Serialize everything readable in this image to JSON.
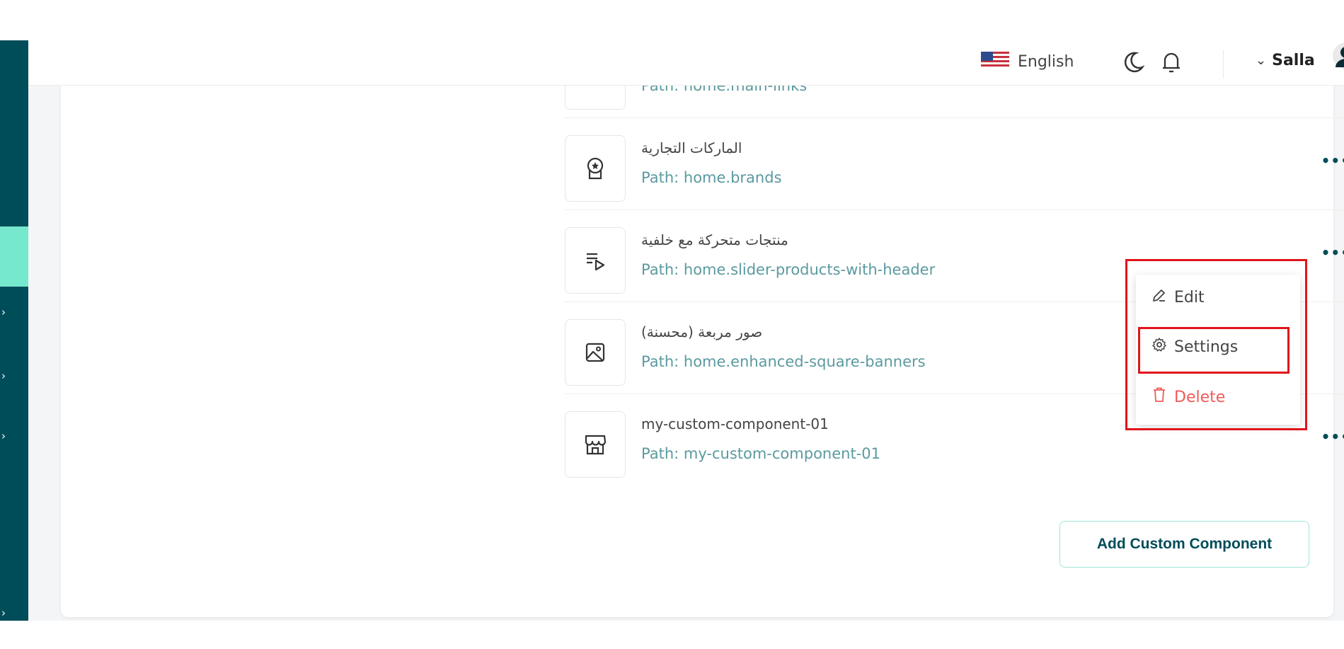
{
  "header": {
    "language_label": "English",
    "user_name": "Salla",
    "icons": [
      "us-flag-icon",
      "moon-icon",
      "bell-icon",
      "chevron-down-icon",
      "avatar"
    ]
  },
  "components": [
    {
      "title": "",
      "path": "Path: home.main-links",
      "icon": "grid-icon"
    },
    {
      "title": "الماركات التجارية",
      "path": "Path: home.brands",
      "icon": "badge-icon"
    },
    {
      "title": "منتجات متحركة مع خلفية",
      "path": "Path: home.slider-products-with-header",
      "icon": "playlist-icon"
    },
    {
      "title": "صور مربعة (محسنة)",
      "path": "Path: home.enhanced-square-banners",
      "icon": "image-icon"
    },
    {
      "title": "my-custom-component-01",
      "path": "Path: my-custom-component-01",
      "icon": "store-icon"
    }
  ],
  "actions_label": "•••",
  "menu": {
    "edit": "Edit",
    "settings": "Settings",
    "delete": "Delete"
  },
  "add_button": "Add Custom Component",
  "colors": {
    "sidebar": "#004d5a",
    "sidebar_active": "#76e8cd",
    "path_text": "#5b9a9f",
    "delete": "#f05a5a",
    "highlight": "#e0141c"
  }
}
